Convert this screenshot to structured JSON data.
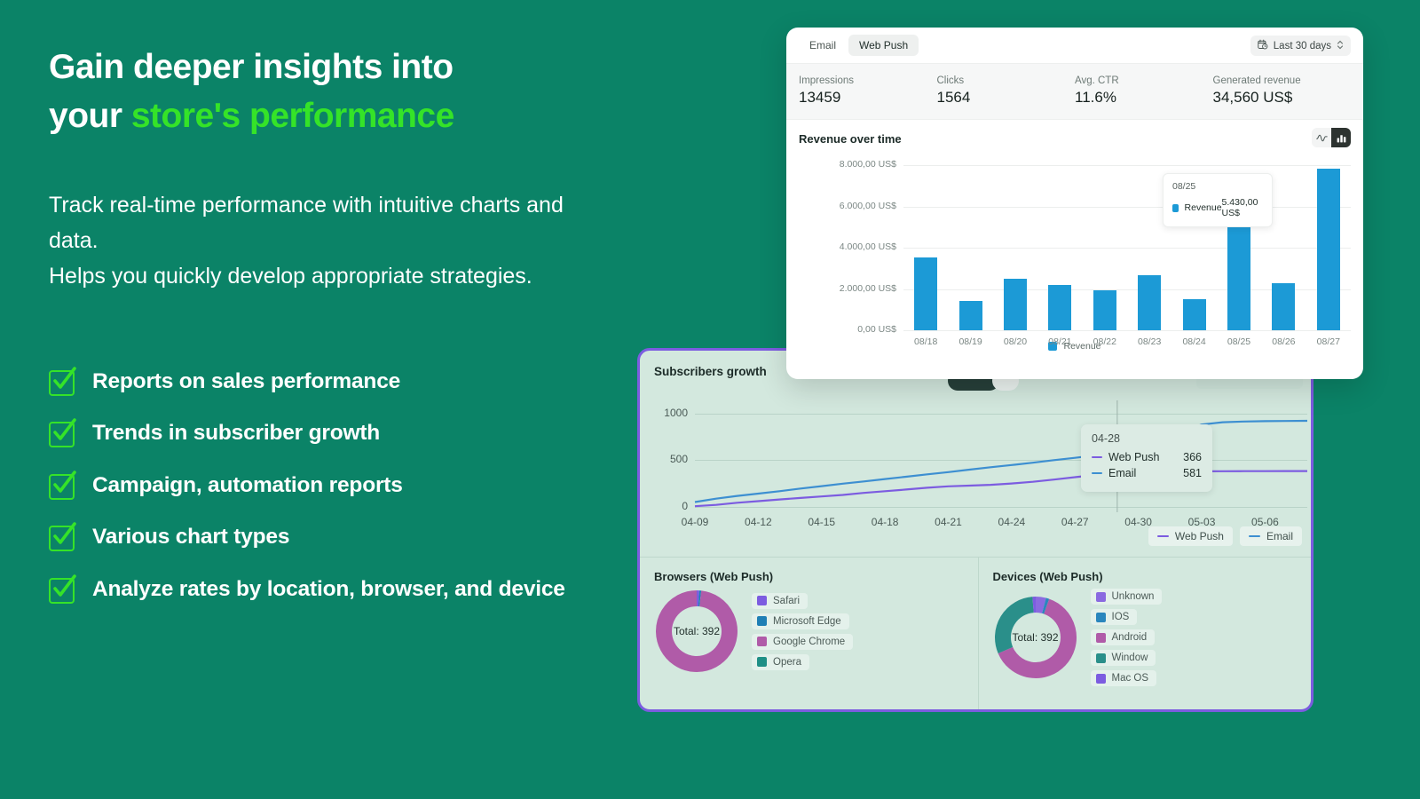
{
  "theme": {
    "bg_green": "#0b8367",
    "accent_green": "#35e328",
    "panel_mint": "#d3e8de",
    "panel_border_purple": "#7c5ce0",
    "bar_blue": "#1c9ad6"
  },
  "marketing": {
    "headline_line1": "Gain deeper insights into",
    "headline_line2_plain": "your ",
    "headline_line2_accent": "store's performance",
    "subcopy": "Track real-time performance with intuitive charts and data.\nHelps you quickly develop appropriate strategies.",
    "features": [
      {
        "label": "Reports on sales performance"
      },
      {
        "label": "Trends in subscriber growth"
      },
      {
        "label": "Campaign, automation reports"
      },
      {
        "label": "Various chart types"
      },
      {
        "label": "Analyze rates by location, browser, and device"
      }
    ]
  },
  "revenue_card": {
    "tabs": [
      {
        "label": "Email",
        "active": false
      },
      {
        "label": "Web Push",
        "active": true
      }
    ],
    "date_range": "Last 30 days",
    "kpis": [
      {
        "label": "Impressions",
        "value": "13459"
      },
      {
        "label": "Clicks",
        "value": "1564"
      },
      {
        "label": "Avg. CTR",
        "value": "11.6%"
      },
      {
        "label": "Generated revenue",
        "value": "34,560 US$"
      }
    ],
    "chart_title": "Revenue over time",
    "toggle": [
      {
        "icon": "line-chart-icon",
        "active": false
      },
      {
        "icon": "bar-chart-icon",
        "active": true
      }
    ],
    "tooltip": {
      "date": "08/25",
      "series_label": "Revenue",
      "series_value": "5.430,00 US$"
    }
  },
  "subscribers_panel": {
    "title": "Subscribers growth",
    "legend": [
      {
        "label": "Web Push",
        "color": "#7c5ce0"
      },
      {
        "label": "Email",
        "color": "#3d8fd1"
      }
    ],
    "tooltip": {
      "date": "04-28",
      "rows": [
        {
          "label": "Web Push",
          "value": "366",
          "color": "#7c5ce0"
        },
        {
          "label": "Email",
          "value": "581",
          "color": "#3d8fd1"
        }
      ]
    }
  },
  "browsers_card": {
    "title": "Browsers (Web Push)",
    "center_label": "Total: 392"
  },
  "devices_card": {
    "title": "Devices (Web Push)",
    "center_label": "Total: 392"
  },
  "chart_data": [
    {
      "type": "bar",
      "title": "Revenue over time",
      "xlabel": "",
      "ylabel": "",
      "ylim": [
        0,
        8000
      ],
      "yticks": [
        0,
        2000,
        4000,
        6000,
        8000
      ],
      "ytick_labels": [
        "0,00 US$",
        "2.000,00 US$",
        "4.000,00 US$",
        "6.000,00 US$",
        "8.000,00 US$"
      ],
      "categories": [
        "08/18",
        "08/19",
        "08/20",
        "08/21",
        "08/22",
        "08/23",
        "08/24",
        "08/25",
        "08/26",
        "08/27"
      ],
      "values": [
        3510,
        1420,
        2510,
        2210,
        1920,
        2680,
        1500,
        5430,
        2280,
        7850
      ],
      "series": [
        {
          "name": "Revenue",
          "color": "#1c9ad6"
        }
      ],
      "legend": [
        "Revenue"
      ],
      "legend_position": "bottom",
      "grid": true
    },
    {
      "type": "line",
      "title": "Subscribers growth",
      "xlabel": "",
      "ylabel": "",
      "ylim": [
        0,
        1100
      ],
      "yticks": [
        0,
        500,
        1000
      ],
      "xticks": [
        "04-09",
        "04-12",
        "04-15",
        "04-18",
        "04-21",
        "04-24",
        "04-27",
        "04-30",
        "05-03",
        "05-06"
      ],
      "series": [
        {
          "name": "Web Push",
          "color": "#7c5ce0",
          "values": [
            8,
            22,
            45,
            62,
            80,
            96,
            112,
            128,
            150,
            168,
            186,
            205,
            220,
            228,
            236,
            250,
            268,
            292,
            318,
            342,
            366,
            372,
            376,
            378,
            380,
            381,
            382,
            382,
            383,
            383
          ]
        },
        {
          "name": "Email",
          "color": "#3d8fd1",
          "values": [
            52,
            88,
            118,
            142,
            168,
            196,
            222,
            248,
            272,
            298,
            322,
            348,
            372,
            398,
            424,
            448,
            472,
            500,
            524,
            552,
            581,
            640,
            700,
            790,
            880,
            905,
            912,
            916,
            918,
            920
          ]
        }
      ],
      "legend": [
        "Web Push",
        "Email"
      ],
      "legend_position": "bottom-right",
      "grid": true,
      "annotation": {
        "date": "04-28",
        "Web Push": 366,
        "Email": 581
      }
    },
    {
      "type": "pie",
      "title": "Browsers (Web Push)",
      "center_label": "Total: 392",
      "total": 392,
      "labels": [
        "Safari",
        "Microsoft Edge",
        "Google Chrome",
        "Opera"
      ],
      "colors": [
        "#7c5ce0",
        "#1f7fb5",
        "#b05ba8",
        "#1f8f86"
      ],
      "values": [
        4,
        3,
        385,
        0
      ]
    },
    {
      "type": "pie",
      "title": "Devices (Web Push)",
      "center_label": "Total: 392",
      "total": 392,
      "labels": [
        "Unknown",
        "IOS",
        "Android",
        "Window",
        "Mac OS"
      ],
      "colors": [
        "#8a6ae0",
        "#2a86bd",
        "#b05ba8",
        "#2a8f8a",
        "#7c5ce0"
      ],
      "values": [
        16,
        5,
        248,
        118,
        5
      ]
    }
  ]
}
